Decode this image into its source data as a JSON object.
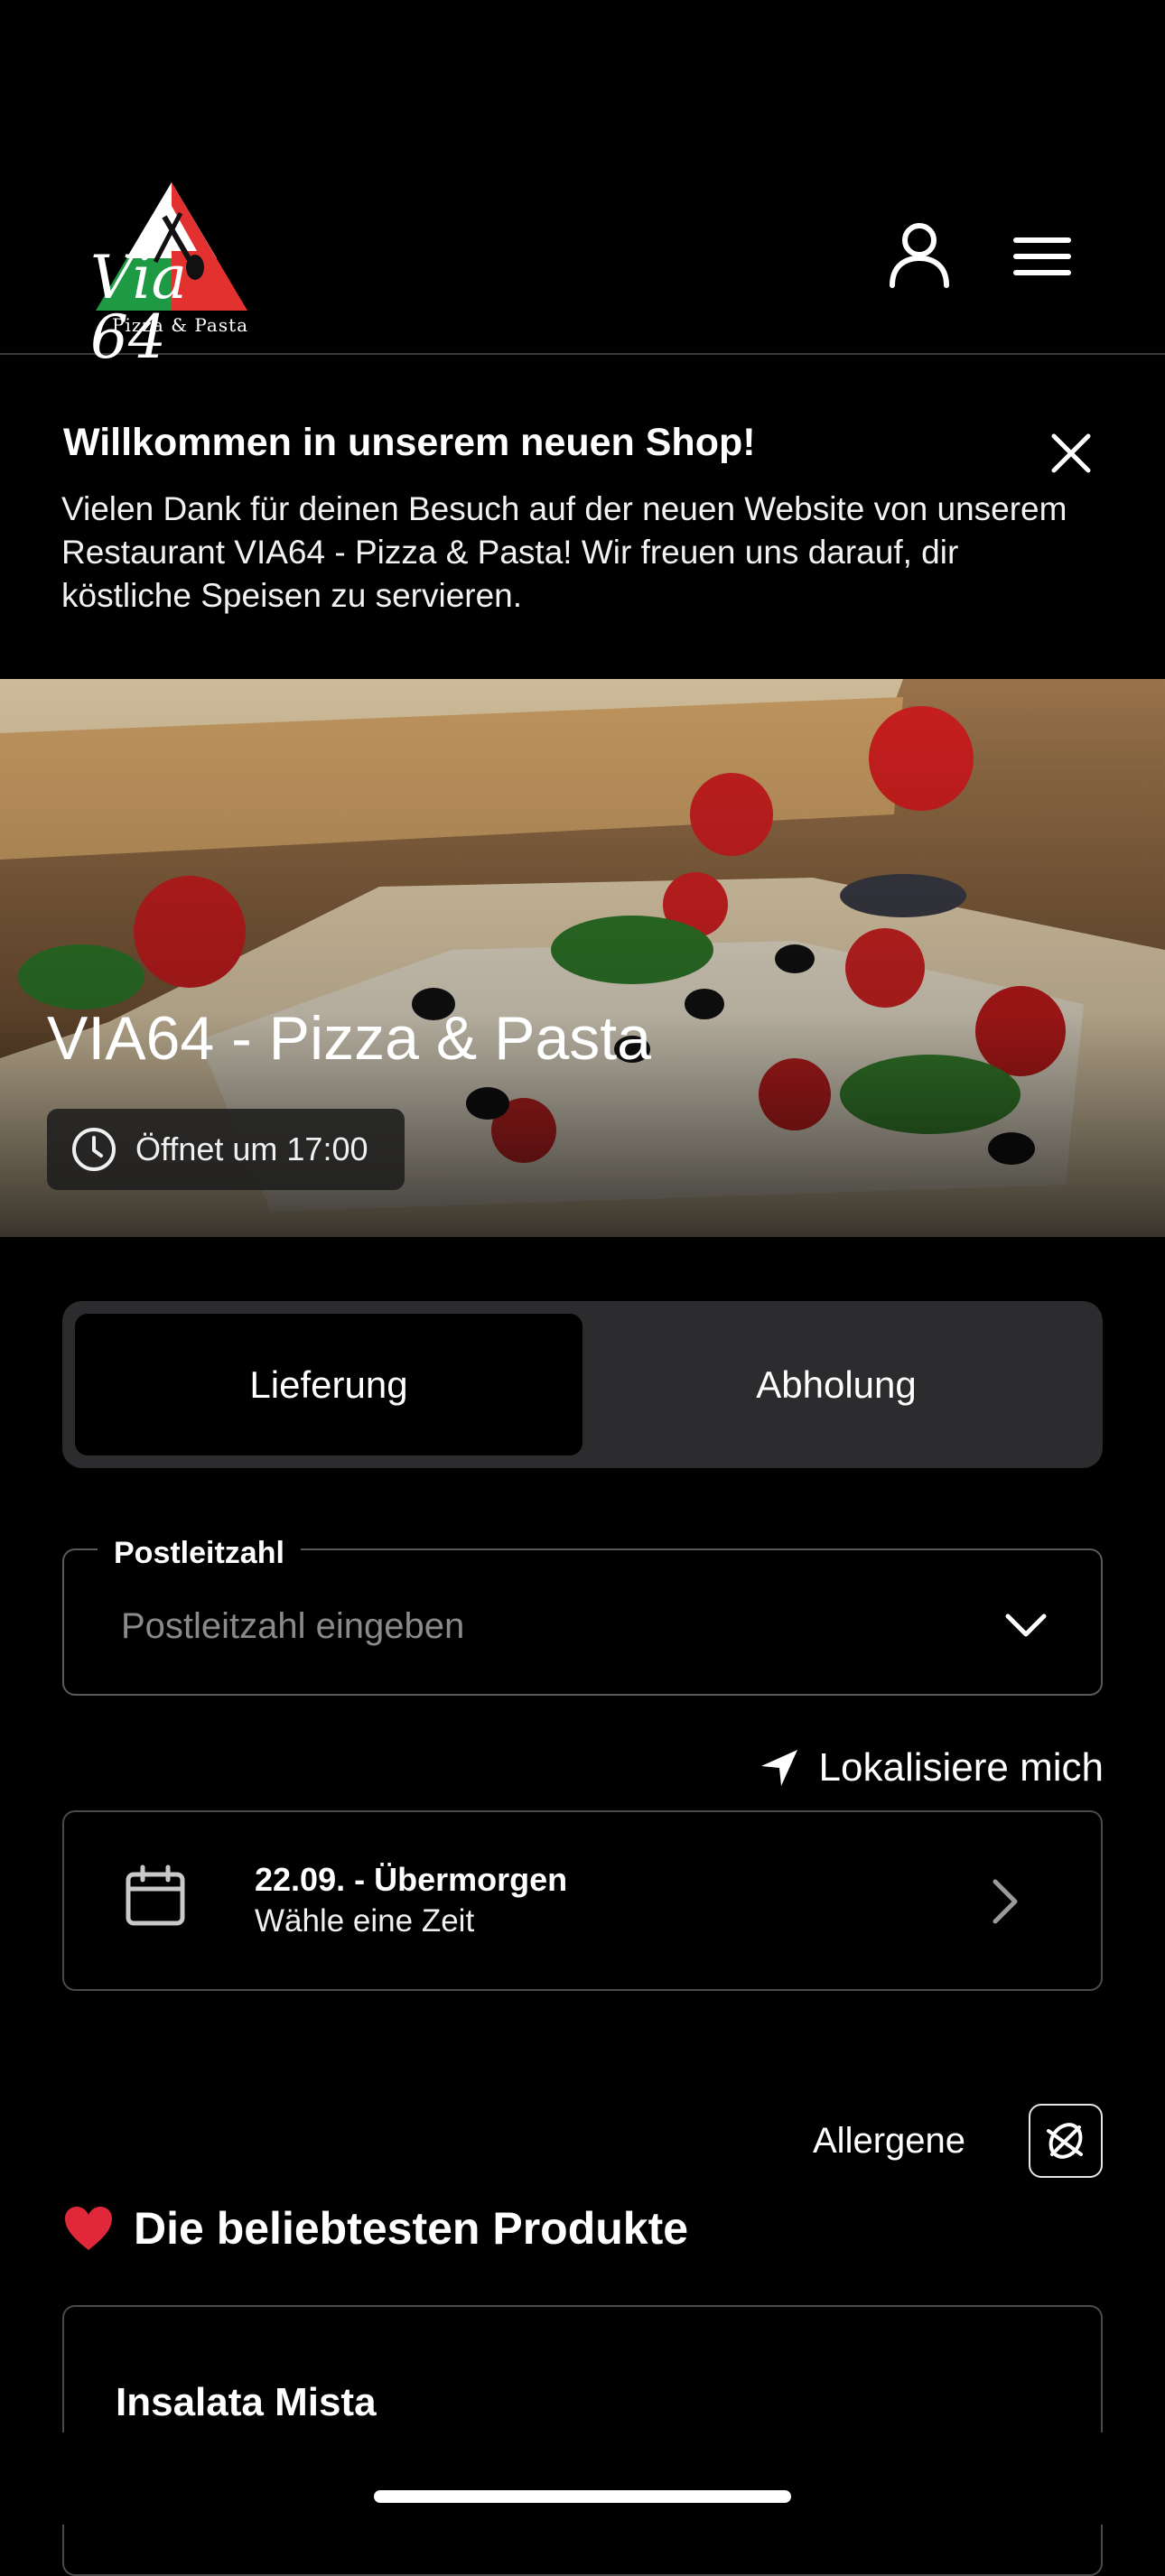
{
  "header": {
    "logo_text": "Via 64",
    "logo_sub": "Pizza & Pasta",
    "user_icon": "user-icon",
    "menu_icon": "hamburger-menu-icon"
  },
  "banner": {
    "title": "Willkommen in unserem neuen Shop!",
    "text": "Vielen Dank für deinen Besuch auf der neuen Website von unserem Restaurant VIA64 - Pizza & Pasta! Wir freuen uns darauf, dir köstliche Speisen zu servieren.",
    "close_icon": "close-icon"
  },
  "hero": {
    "title": "VIA64 - Pizza & Pasta",
    "status": "Öffnet um 17:00",
    "status_icon": "clock-icon"
  },
  "order_mode": {
    "options": [
      "Lieferung",
      "Abholung"
    ],
    "selected": "Lieferung"
  },
  "postal": {
    "label": "Postleitzahl",
    "placeholder": "Postleitzahl eingeben",
    "value": ""
  },
  "locate": {
    "label": "Lokalisiere mich",
    "icon": "location-arrow-icon"
  },
  "schedule": {
    "date": "22.09. - Übermorgen",
    "time_prompt": "Wähle eine Zeit",
    "icon": "calendar-icon"
  },
  "allergens": {
    "label": "Allergene",
    "icon": "allergen-icon"
  },
  "popular": {
    "title": "Die beliebtesten Produkte",
    "icon": "heart-icon",
    "products": [
      {
        "name": "Insalata Mista"
      }
    ]
  },
  "colors": {
    "background": "#000000",
    "toggle_bg": "#2c2c2e",
    "logo_green": "#1e9a45",
    "logo_red": "#e3312f",
    "heart": "#e0283a"
  }
}
